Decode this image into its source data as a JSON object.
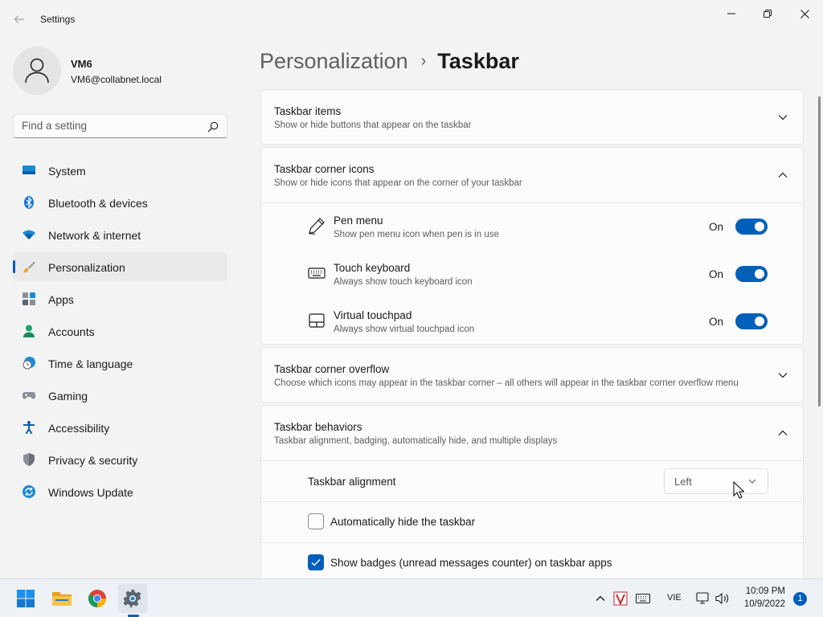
{
  "window": {
    "title": "Settings",
    "minimize_icon": "minimize-icon",
    "maximize_icon": "restore-icon",
    "close_icon": "close-icon"
  },
  "profile": {
    "name": "VM6",
    "email": "VM6@collabnet.local"
  },
  "search": {
    "placeholder": "Find a setting",
    "value": ""
  },
  "sidebar": {
    "selected": "Personalization",
    "items": [
      {
        "label": "System",
        "icon": "system-icon"
      },
      {
        "label": "Bluetooth & devices",
        "icon": "bluetooth-icon"
      },
      {
        "label": "Network & internet",
        "icon": "wifi-icon"
      },
      {
        "label": "Personalization",
        "icon": "paintbrush-icon"
      },
      {
        "label": "Apps",
        "icon": "apps-icon"
      },
      {
        "label": "Accounts",
        "icon": "accounts-icon"
      },
      {
        "label": "Time & language",
        "icon": "clock-globe-icon"
      },
      {
        "label": "Gaming",
        "icon": "gamepad-icon"
      },
      {
        "label": "Accessibility",
        "icon": "accessibility-icon"
      },
      {
        "label": "Privacy & security",
        "icon": "shield-icon"
      },
      {
        "label": "Windows Update",
        "icon": "update-icon"
      }
    ]
  },
  "breadcrumb": {
    "parent": "Personalization",
    "separator": "›",
    "current": "Taskbar"
  },
  "sections": {
    "taskbar_items": {
      "title": "Taskbar items",
      "description": "Show or hide buttons that appear on the taskbar",
      "expanded": false
    },
    "corner_icons": {
      "title": "Taskbar corner icons",
      "description": "Show or hide icons that appear on the corner of your taskbar",
      "expanded": true,
      "items": [
        {
          "title": "Pen menu",
          "description": "Show pen menu icon when pen is in use",
          "state": "On",
          "icon": "pen-icon"
        },
        {
          "title": "Touch keyboard",
          "description": "Always show touch keyboard icon",
          "state": "On",
          "icon": "keyboard-icon"
        },
        {
          "title": "Virtual touchpad",
          "description": "Always show virtual touchpad icon",
          "state": "On",
          "icon": "touchpad-icon"
        }
      ]
    },
    "corner_overflow": {
      "title": "Taskbar corner overflow",
      "description": "Choose which icons may appear in the taskbar corner – all others will appear in the taskbar corner overflow menu",
      "expanded": false
    },
    "behaviors": {
      "title": "Taskbar behaviors",
      "description": "Taskbar alignment, badging, automatically hide, and multiple displays",
      "expanded": true,
      "alignment_label": "Taskbar alignment",
      "alignment_value": "Left",
      "auto_hide_label": "Automatically hide the taskbar",
      "auto_hide_checked": false,
      "badges_label": "Show badges (unread messages counter) on taskbar apps",
      "badges_checked": true
    }
  },
  "taskbar": {
    "apps": [
      "start-icon",
      "file-explorer-icon",
      "chrome-icon",
      "settings-icon"
    ],
    "active_app": "settings-icon",
    "tray_language": "VIE",
    "clock_time": "10:09 PM",
    "clock_date": "10/9/2022",
    "notification_count": "1"
  },
  "colors": {
    "accent": "#005fb8",
    "background": "#f3f3f3",
    "card": "#fbfbfb",
    "secondary_text": "#5d5d5d"
  }
}
